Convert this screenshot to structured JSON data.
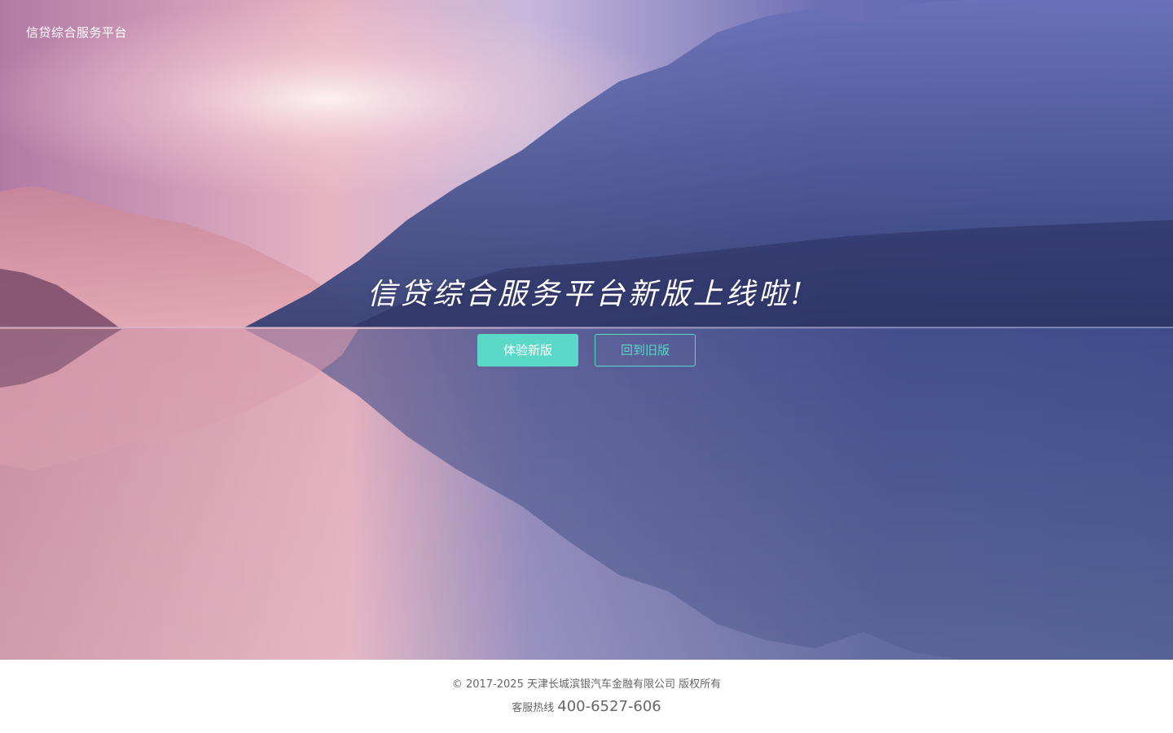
{
  "header": {
    "brand": "信贷综合服务平台"
  },
  "hero": {
    "headline": "信贷综合服务平台新版上线啦!",
    "background": "mountain-lake-sunrise-image"
  },
  "actions": {
    "try_new_label": "体验新版",
    "back_old_label": "回到旧版"
  },
  "footer": {
    "copyright": "© 2017-2025 天津长城滨银汽车金融有限公司 版权所有",
    "hotline_label": "客服热线",
    "hotline_number": "400-6527-606"
  },
  "colors": {
    "accent": "#5bd8c8",
    "footer_text": "#666666"
  }
}
